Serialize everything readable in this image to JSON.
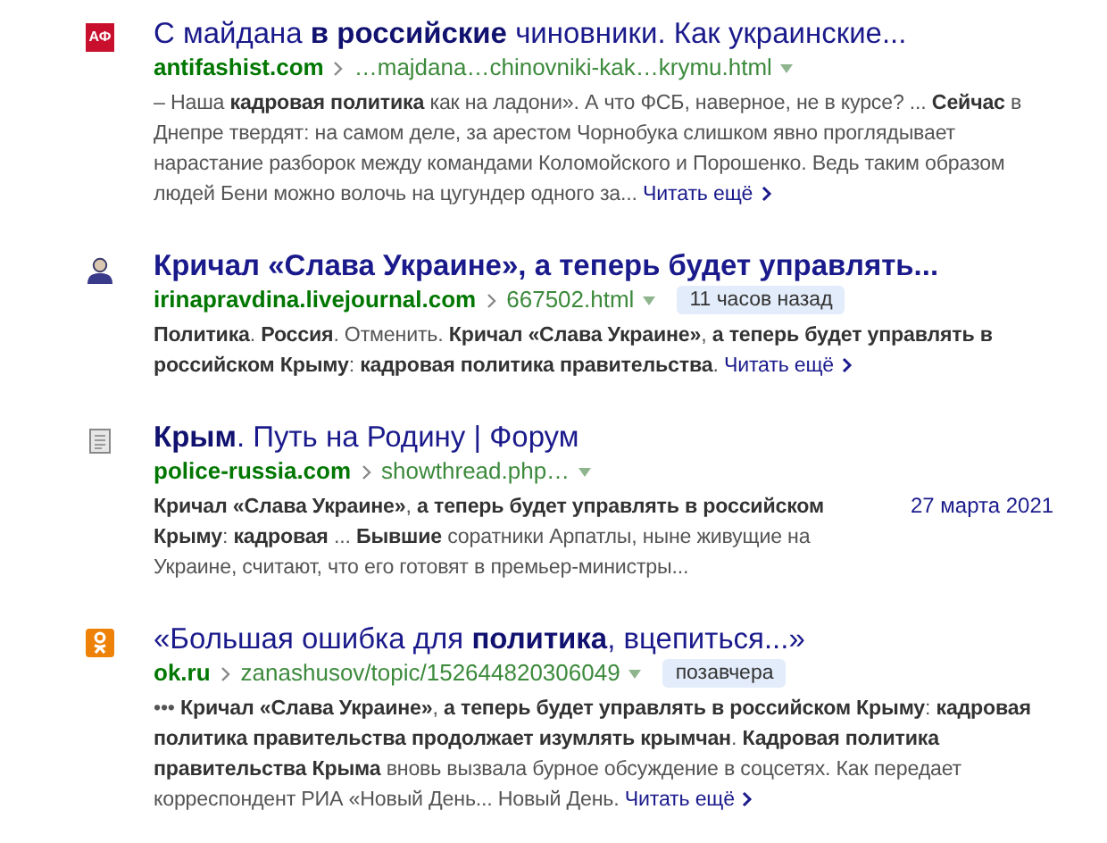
{
  "results": [
    {
      "favicon": {
        "kind": "badge",
        "text": "АФ"
      },
      "title": "С майдана **в российские** чиновники. Как украинские...",
      "title_bold": false,
      "domain": "antifashist.com",
      "path": "…majdana…chinovniki-kak…krymu.html",
      "snippet": "– Наша **кадровая политика** как на ладони». А что ФСБ, наверное, не в курсе? ... **Сейчас** в Днепре твердят: на самом деле, за арестом Чорнобука слишком явно проглядывает нарастание разборок между командами Коломойского и Порошенко. Ведь таким образом людей Бени можно волочь на цугундер одного за...",
      "more": "Читать ещё"
    },
    {
      "favicon": {
        "kind": "person"
      },
      "title": "Кричал «Слава Украине», а теперь будет управлять...",
      "title_bold": true,
      "domain": "irinapravdina.livejournal.com",
      "path": "667502.html",
      "age": "11 часов назад",
      "snippet": "**Политика**. **Россия**. Отменить. **Кричал «Слава Украине»**, **а теперь будет управлять в российском Крыму**: **кадровая политика правительства**.",
      "more": "Читать ещё"
    },
    {
      "favicon": {
        "kind": "document"
      },
      "title": "**Крым**. Путь на Родину | Форум",
      "title_bold": false,
      "domain": "police-russia.com",
      "path": "showthread.php…",
      "snippet": "**Кричал «Слава Украине»**, **а теперь будет управлять в российском Крыму**: **кадровая** ... **Бывшие** соратники Арпатлы, ныне живущие на Украине, считают, что его готовят в премьер-министры...",
      "date": "27 марта 2021"
    },
    {
      "favicon": {
        "kind": "ok"
      },
      "title": "«Большая ошибка для **политика**, вцепиться...»",
      "title_bold": false,
      "domain": "ok.ru",
      "path": "zanashusov/topic/152644820306049",
      "age": "позавчера",
      "snippet": "••• **Кричал «Слава Украине»**, **а теперь будет управлять в российском Крыму**: **кадровая политика правительства продолжает изумлять крымчан**. **Кадровая политика правительства Крыма** вновь вызвала бурное обсуждение в соцсетях. Как передает корреспондент РИА «Новый День... Новый День.",
      "more": "Читать ещё"
    }
  ]
}
